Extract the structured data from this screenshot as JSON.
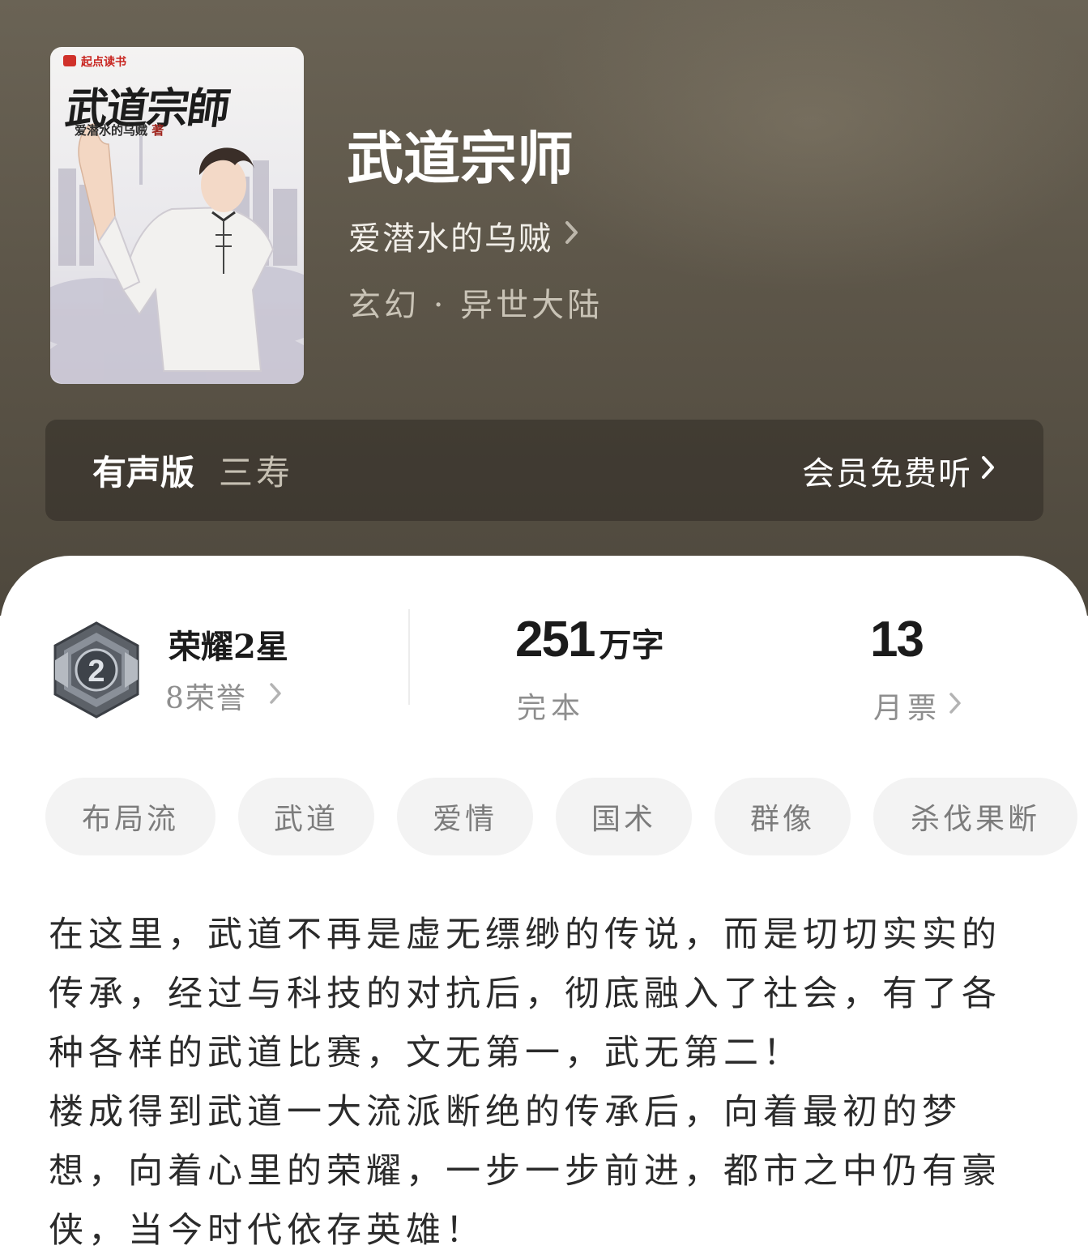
{
  "book": {
    "title": "武道宗师",
    "author": "爱潜水的乌贼",
    "category": "玄幻 · 异世大陆",
    "cover": {
      "brand": "起点读书",
      "title": "武道宗師",
      "author": "爱潜水的乌贼",
      "author_suffix": "著"
    }
  },
  "audio": {
    "label": "有声版",
    "narrator": "三寿",
    "action": "会员免费听"
  },
  "stats": {
    "honor_title": "荣耀2星",
    "honor_count": "8荣誉",
    "badge_number": "2",
    "word_count": "251",
    "word_unit": "万字",
    "status": "完本",
    "monthly_votes": "13",
    "votes_label": "月票"
  },
  "tags": [
    "布局流",
    "武道",
    "爱情",
    "国术",
    "群像",
    "杀伐果断"
  ],
  "synopsis": [
    "在这里，武道不再是虚无缥缈的传说，而是切切实实的传承，经过与科技的对抗后，彻底融入了社会，有了各种各样的武道比赛，文无第一，武无第二！",
    "楼成得到武道一大流派断绝的传承后，向着最初的梦想，向着心里的荣耀，一步一步前进，都市之中仍有豪侠，当今时代依存英雄！"
  ],
  "icons": {
    "author_arrow": "chevron-right-icon",
    "audio_arrow": "chevron-right-icon",
    "honor_arrow": "chevron-right-icon",
    "votes_arrow": "chevron-right-icon",
    "badge": "honor-badge-icon"
  },
  "colors": {
    "hero_bg": "#5d5649",
    "card_bg": "#ffffff",
    "tag_bg": "#f3f3f3",
    "primary_text": "#1b1b1b",
    "secondary_text": "#8e8e8e"
  }
}
